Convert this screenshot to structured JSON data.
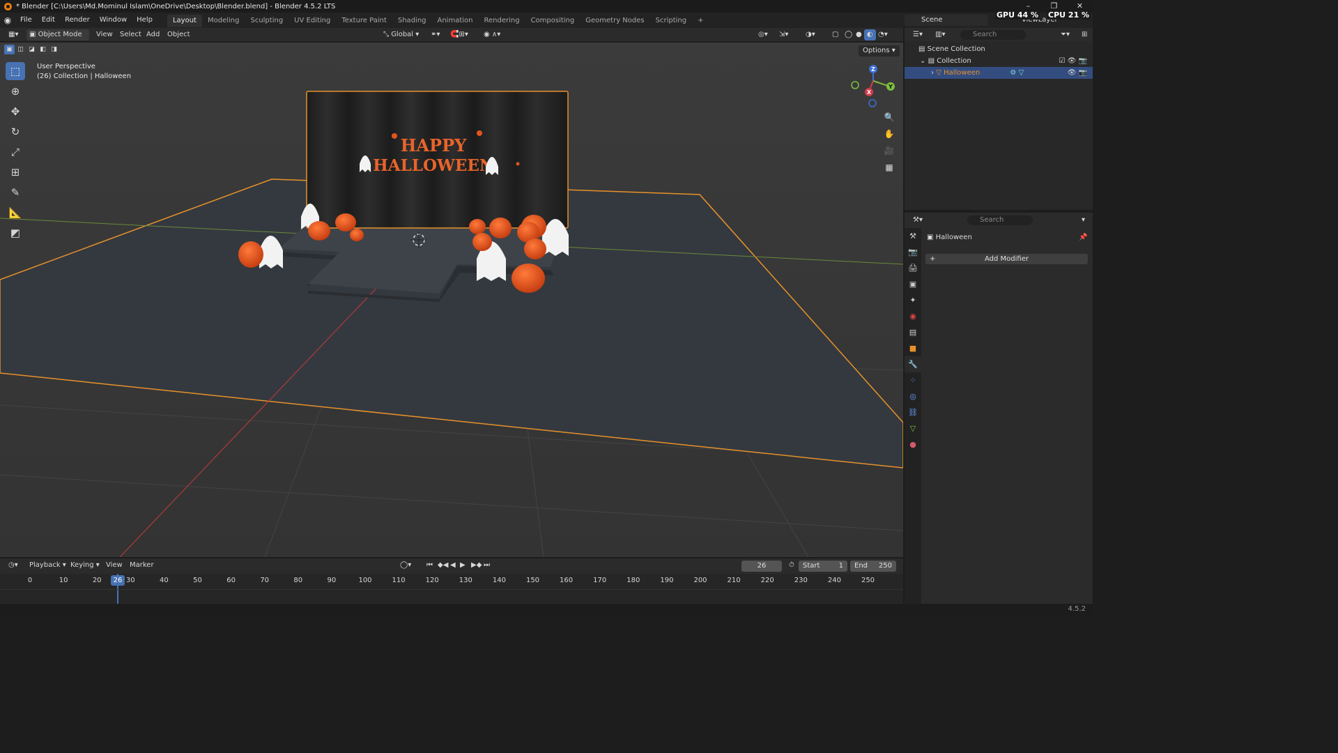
{
  "window": {
    "title": "* Blender [C:\\Users\\Md.Mominul Islam\\OneDrive\\Desktop\\Blender.blend] - Blender 4.5.2 LTS",
    "minimize": "–",
    "maximize": "❐",
    "close": "✕"
  },
  "menu": {
    "items": [
      "File",
      "Edit",
      "Render",
      "Window",
      "Help"
    ],
    "workspaces": [
      "Layout",
      "Modeling",
      "Sculpting",
      "UV Editing",
      "Texture Paint",
      "Shading",
      "Animation",
      "Rendering",
      "Compositing",
      "Geometry Nodes",
      "Scripting"
    ],
    "active_workspace": "Layout",
    "add_workspace": "+",
    "scene": "Scene",
    "view_layer": "ViewLayer",
    "gpu_label": "GPU",
    "gpu_value": "44 %",
    "cpu_label": "CPU",
    "cpu_value": "21 %"
  },
  "viewport_header": {
    "mode": "Object Mode",
    "view": "View",
    "select": "Select",
    "add": "Add",
    "object": "Object",
    "transform_orientation": "Global",
    "options": "Options"
  },
  "viewport": {
    "perspective": "User Perspective",
    "collection_info": "(26) Collection | Halloween",
    "banner_line1": "HAPPY",
    "banner_line2": "HALLOWEEN",
    "gizmo": {
      "x": "X",
      "y": "Y",
      "z": "Z"
    }
  },
  "timeline": {
    "playback": "Playback",
    "keying": "Keying",
    "view": "View",
    "marker": "Marker",
    "current_frame": "26",
    "start_label": "Start",
    "start": "1",
    "end_label": "End",
    "end": "250",
    "ticks": [
      "0",
      "10",
      "20",
      "30",
      "40",
      "50",
      "60",
      "70",
      "80",
      "90",
      "100",
      "110",
      "120",
      "130",
      "140",
      "150",
      "160",
      "170",
      "180",
      "190",
      "200",
      "210",
      "220",
      "230",
      "240",
      "250"
    ],
    "frame_marker": "26"
  },
  "outliner": {
    "search_placeholder": "Search",
    "scene_collection": "Scene Collection",
    "collection": "Collection",
    "object": "Halloween"
  },
  "properties": {
    "search_placeholder": "Search",
    "object_name": "Halloween",
    "add_modifier": "Add Modifier"
  },
  "statusbar": {
    "version": "4.5.2"
  },
  "colors": {
    "accent": "#4772b3",
    "selection": "#e8912b",
    "pumpkin": "#e2541c"
  }
}
